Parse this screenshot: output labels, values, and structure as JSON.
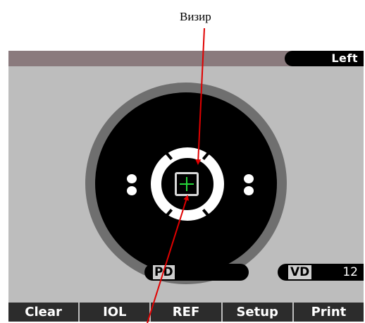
{
  "caption": "Визир",
  "screen": {
    "side_indicator": "Left",
    "pd_label": "PD",
    "vd_label": "VD",
    "vd_value": "12"
  },
  "softkeys": [
    "Clear",
    "IOL",
    "REF",
    "Setup",
    "Print"
  ],
  "colors": {
    "screen_bg": "#bdbdbd",
    "top_bar": "#8a7a7d",
    "crosshair": "#26d63a",
    "annotation_arrow": "#e00000"
  }
}
